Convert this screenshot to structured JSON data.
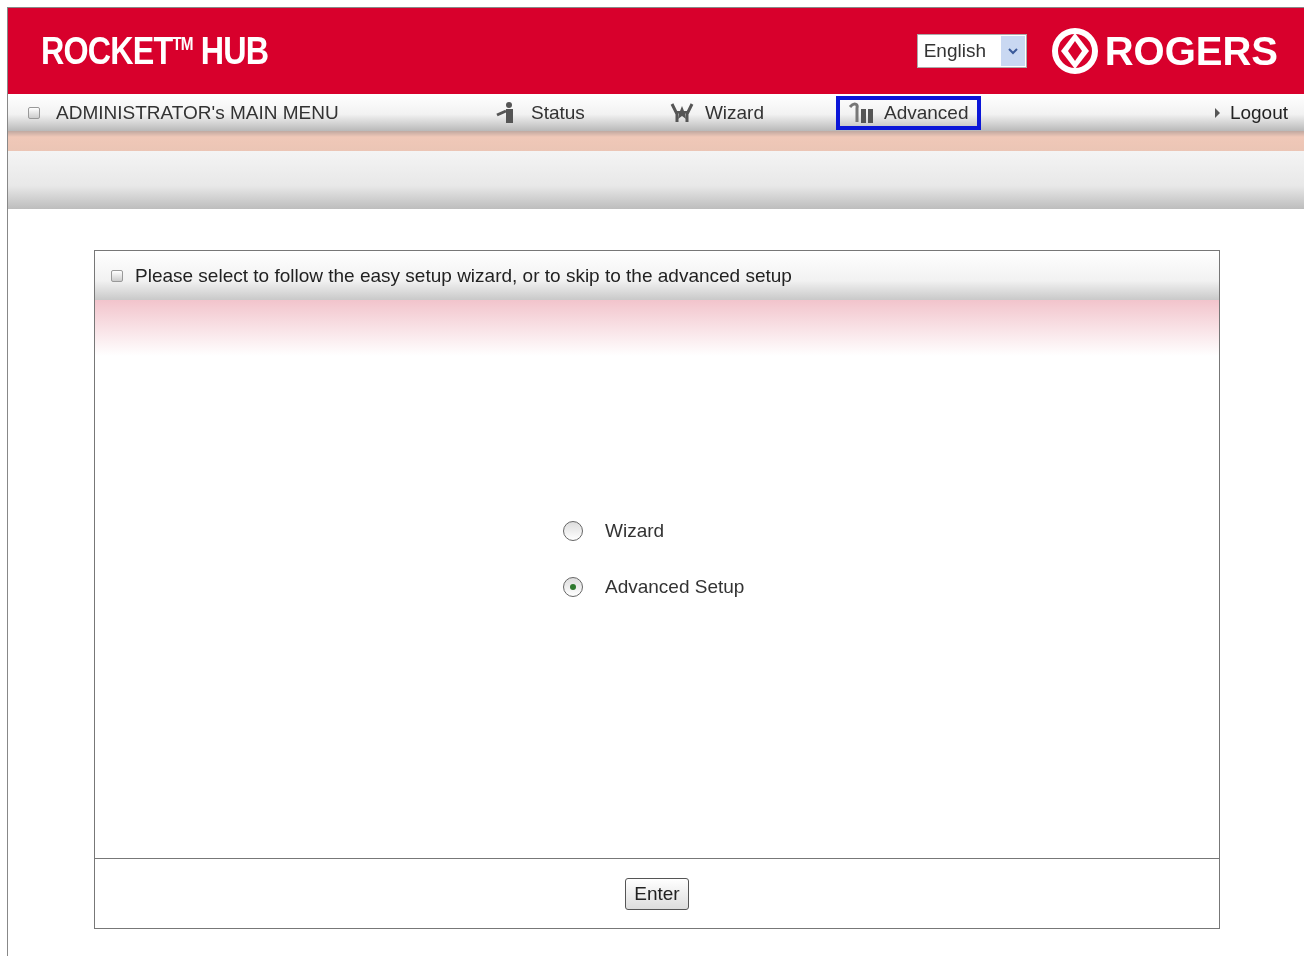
{
  "header": {
    "product_logo": "ROCKET$^{TM}$ HUB",
    "language_select": {
      "value": "English"
    },
    "brand_logo": "ROGERS"
  },
  "menu": {
    "title": "ADMINISTRATOR's MAIN MENU",
    "items": [
      {
        "label": "Status",
        "highlighted": false
      },
      {
        "label": "Wizard",
        "highlighted": false
      },
      {
        "label": "Advanced",
        "highlighted": true
      }
    ],
    "logout": "Logout"
  },
  "panel": {
    "title": "Please select to follow the easy setup wizard, or to skip to the advanced setup",
    "options": [
      {
        "label": "Wizard",
        "selected": false
      },
      {
        "label": "Advanced Setup",
        "selected": true
      }
    ],
    "button": "Enter"
  }
}
